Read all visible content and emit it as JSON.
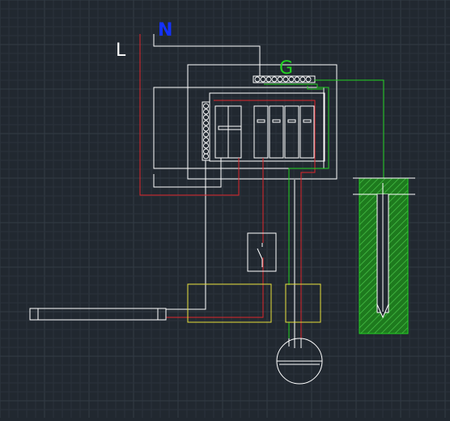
{
  "labels": {
    "live": "L",
    "neutral": "N",
    "ground": "G"
  },
  "colors": {
    "background": "#212830",
    "grid_minor": "#2a323b",
    "grid_major": "#323b45",
    "white": "#ffffff",
    "live_wire": "#e0262b",
    "neutral_label": "#1432ff",
    "ground_wire": "#22d322",
    "yellow_box": "#e8e03a",
    "earth_hatch": "#1e7a1e"
  }
}
